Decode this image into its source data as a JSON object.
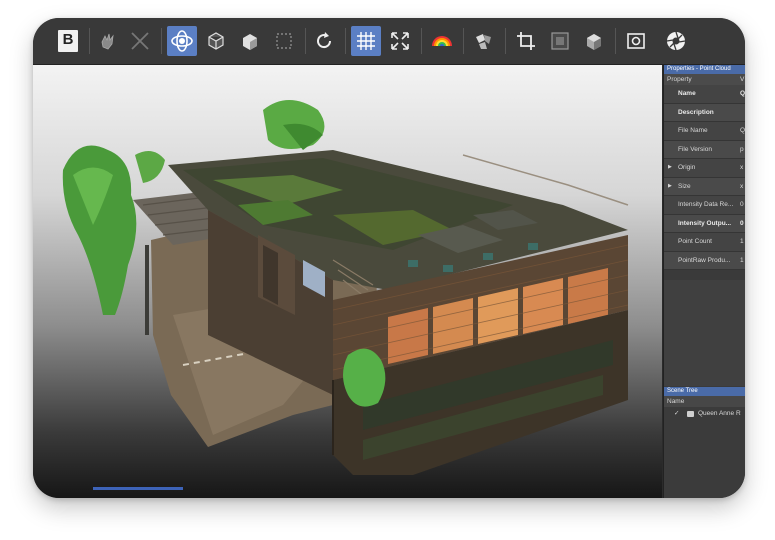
{
  "toolbar": {
    "buttons": [
      {
        "name": "b-tool-icon",
        "label": "B",
        "active": false
      },
      {
        "name": "hand-pan-icon",
        "label": "",
        "active": false
      },
      {
        "name": "cross-icon",
        "label": "",
        "active": false
      },
      {
        "name": "orbit-icon",
        "label": "",
        "active": true
      },
      {
        "name": "cube-view-icon",
        "label": "",
        "active": false
      },
      {
        "name": "shaded-cube-icon",
        "label": "",
        "active": false
      },
      {
        "name": "selection-box-icon",
        "label": "",
        "active": false
      },
      {
        "name": "rotate-icon",
        "label": "",
        "active": false
      },
      {
        "name": "grid-icon",
        "label": "",
        "active": true
      },
      {
        "name": "fit-extents-icon",
        "label": "",
        "active": false
      },
      {
        "name": "color-ramp-icon",
        "label": "",
        "active": false
      },
      {
        "name": "pieces-icon",
        "label": "",
        "active": false
      },
      {
        "name": "crop-icon",
        "label": "",
        "active": false
      },
      {
        "name": "section-box-icon",
        "label": "",
        "active": false
      },
      {
        "name": "clip-cube-icon",
        "label": "",
        "active": false
      },
      {
        "name": "screenshot-icon",
        "label": "",
        "active": false
      },
      {
        "name": "aperture-icon",
        "label": "",
        "active": false
      }
    ]
  },
  "properties_panel": {
    "title": "Properties - Point Cloud",
    "column_property": "Property",
    "column_value": "V",
    "rows": [
      {
        "label": "Name",
        "value": "Q",
        "bold": true,
        "expander": false
      },
      {
        "label": "Description",
        "value": "",
        "bold": true,
        "expander": false
      },
      {
        "label": "File Name",
        "value": "Q",
        "bold": false,
        "expander": false
      },
      {
        "label": "File Version",
        "value": "p",
        "bold": false,
        "expander": false
      },
      {
        "label": "Origin",
        "value": "x",
        "bold": false,
        "expander": true
      },
      {
        "label": "Size",
        "value": "x",
        "bold": false,
        "expander": true
      },
      {
        "label": "Intensity Data Re...",
        "value": "0",
        "bold": false,
        "expander": false
      },
      {
        "label": "Intensity Outpu...",
        "value": "0",
        "bold": true,
        "expander": false
      },
      {
        "label": "Point Count",
        "value": "1",
        "bold": false,
        "expander": false
      },
      {
        "label": "PointRaw Produ...",
        "value": "1",
        "bold": false,
        "expander": false
      }
    ]
  },
  "scene_tree": {
    "title": "Scene Tree",
    "column_name": "Name",
    "node": {
      "checkmark": "✓",
      "label": "Queen Anne R"
    }
  },
  "colors": {
    "accent": "#5b7fc4",
    "panel_header": "#4a6ba8",
    "toolbar_bg": "#393939"
  }
}
